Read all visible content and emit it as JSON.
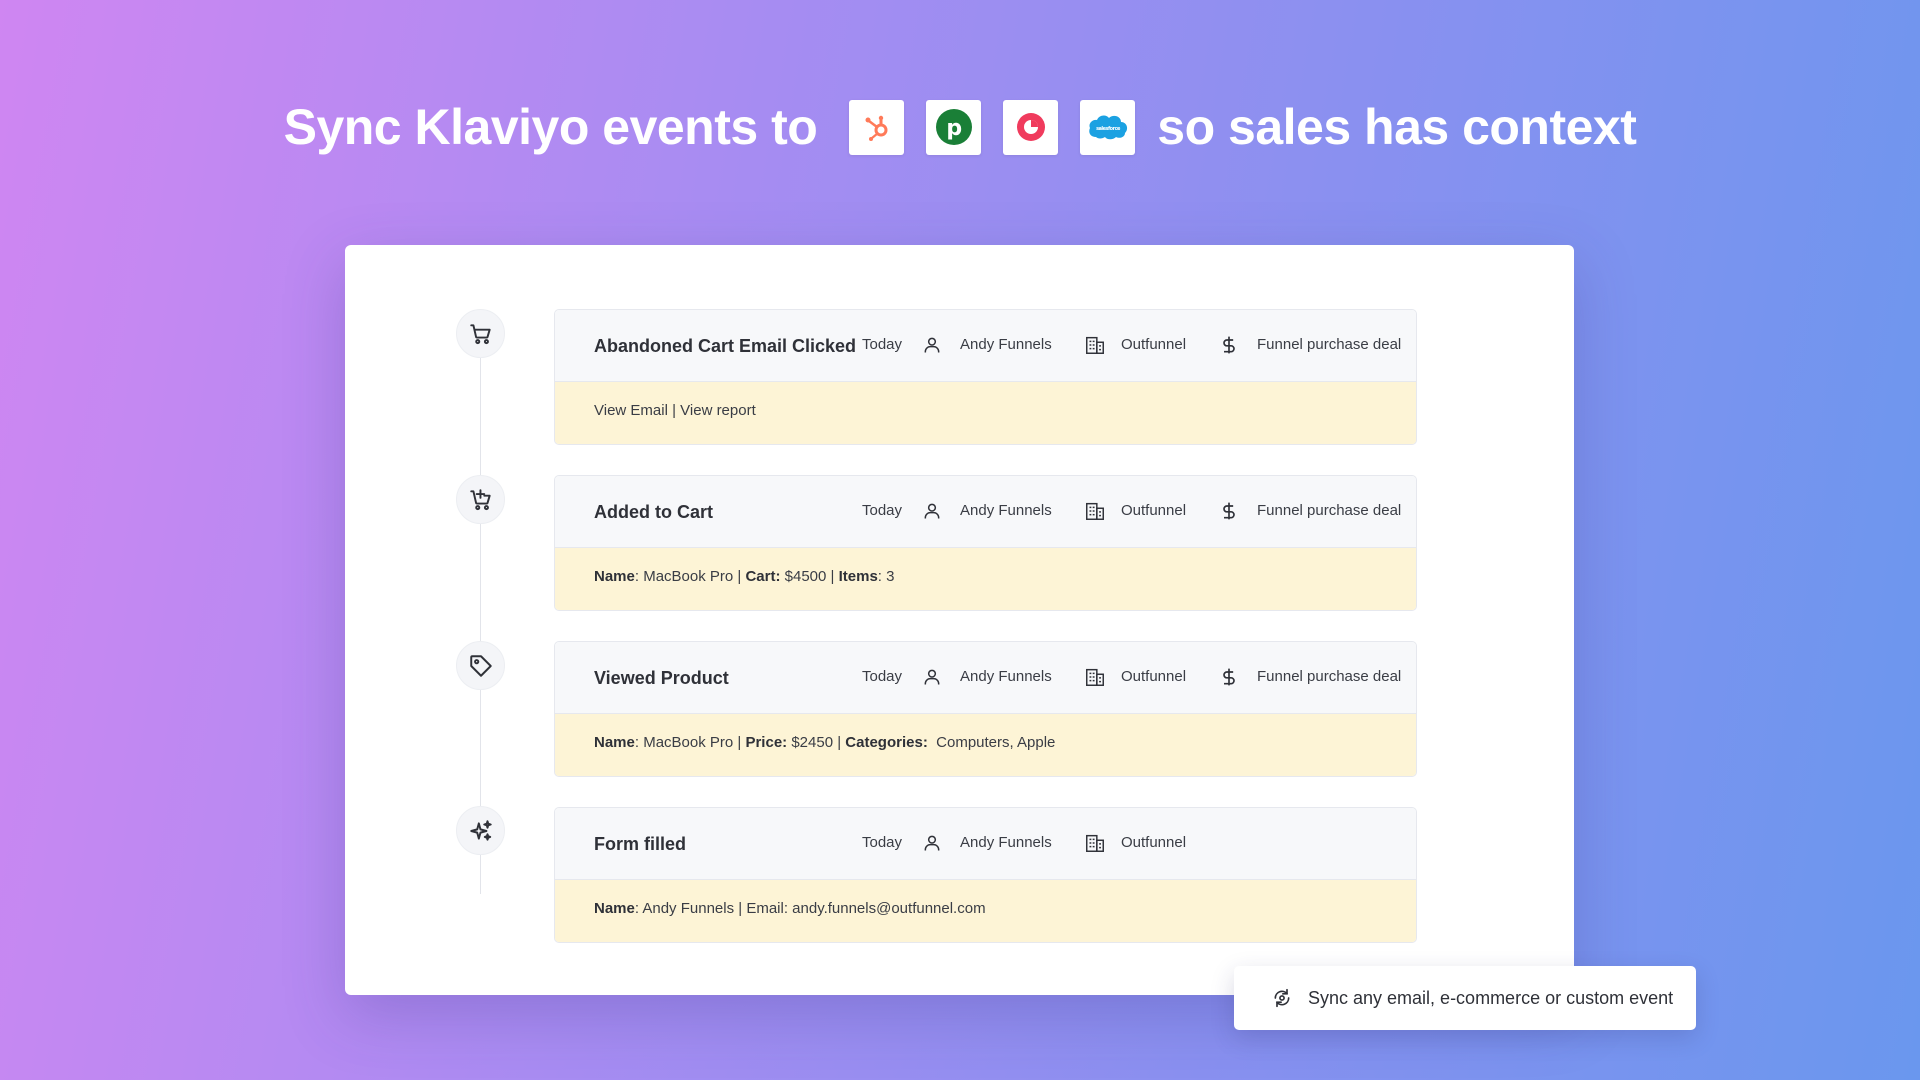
{
  "headline": {
    "before": "Sync Klaviyo events to",
    "after": "so sales has context",
    "logos": [
      "hubspot-logo",
      "pipedrive-logo",
      "copper-logo",
      "salesforce-logo"
    ]
  },
  "colors": {
    "accent_bg": "#fdf4d6",
    "hubspot": "#ff7a59",
    "pipedrive": "#1a7f37",
    "copper": "#f03b5d",
    "salesforce": "#1ba1e2"
  },
  "events": [
    {
      "icon": "shopping-cart-icon",
      "title": "Abandoned Cart Email Clicked",
      "date": "Today",
      "person": "Andy Funnels",
      "company": "Outfunnel",
      "deal": "Funnel purchase deal",
      "links": {
        "view_email": "View Email",
        "sep": " | ",
        "view_report": "View report"
      }
    },
    {
      "icon": "cart-add-icon",
      "title": "Added to Cart",
      "date": "Today",
      "person": "Andy Funnels",
      "company": "Outfunnel",
      "deal": "Funnel purchase deal",
      "details": [
        {
          "label": "Name",
          "value": ": MacBook Pro | "
        },
        {
          "label": "Cart:",
          "value": " $4500 | "
        },
        {
          "label": "Items",
          "value": ": 3"
        }
      ]
    },
    {
      "icon": "tag-icon",
      "title": "Viewed Product",
      "date": "Today",
      "person": "Andy Funnels",
      "company": "Outfunnel",
      "deal": "Funnel purchase deal",
      "details": [
        {
          "label": "Name",
          "value": ": MacBook Pro | "
        },
        {
          "label": "Price:",
          "value": " $2450 | "
        },
        {
          "label": "Categories:",
          "value": "  Computers, Apple"
        }
      ]
    },
    {
      "icon": "sparkles-icon",
      "title": "Form filled",
      "date": "Today",
      "person": "Andy Funnels",
      "company": "Outfunnel",
      "details": [
        {
          "label": "Name",
          "value": ": Andy Funnels | Email: andy.funnels@outfunnel.com"
        }
      ]
    }
  ],
  "toast": {
    "text": "Sync any email, e-commerce or custom event",
    "icon": "sync-icon"
  }
}
